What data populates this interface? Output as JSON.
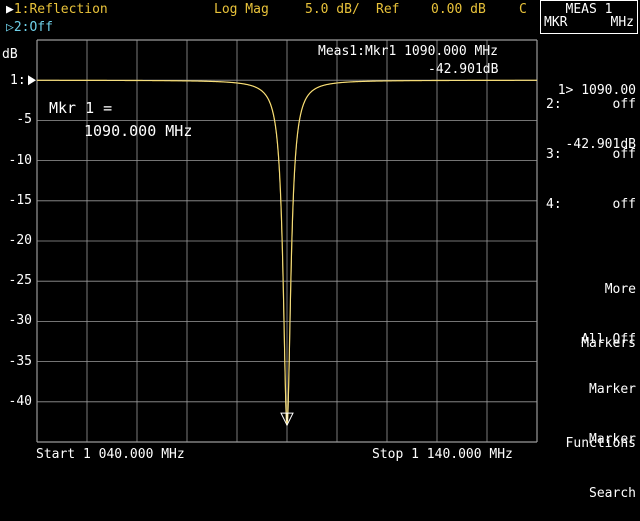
{
  "header": {
    "trace1": "1:Reflection",
    "trace2": "2:Off",
    "format": "Log Mag",
    "scale": "5.0 dB/",
    "ref_label": "Ref",
    "ref_value": "0.00 dB",
    "channel": "C"
  },
  "meas_box": {
    "line1": "MEAS 1",
    "line2_left": "MKR",
    "line2_right": "MHz"
  },
  "plot": {
    "y_unit": "dB",
    "ref_tick": "1:",
    "y_ticks": [
      "-5",
      "-10",
      "-15",
      "-20",
      "-25",
      "-30",
      "-35",
      "-40"
    ],
    "marker_readout_line1": "Meas1:Mkr1 1090.000 MHz",
    "marker_readout_line2": "-42.901dB",
    "mkr_label_line1": "Mkr 1 =",
    "mkr_label_line2": "1090.000 MHz",
    "start": "Start 1 040.000 MHz",
    "stop": "Stop 1 140.000 MHz"
  },
  "softkeys": {
    "mkr1_line1": "1> 1090.00",
    "mkr1_line2": "-42.901dB",
    "mkr2_label": "2:",
    "mkr2_value": "off",
    "mkr3_label": "3:",
    "mkr3_value": "off",
    "mkr4_label": "4:",
    "mkr4_value": "off",
    "more_markers_1": "More",
    "more_markers_2": "Markers",
    "all_off": "All Off",
    "marker_functions_1": "Marker",
    "marker_functions_2": "Functions",
    "marker_search_1": "Marker",
    "marker_search_2": "Search"
  },
  "colors": {
    "trace": "#e8c23a",
    "grid": "#9a9a9a",
    "inactive": "#6fd0e8"
  },
  "chart_data": {
    "type": "line",
    "x_unit": "MHz",
    "y_unit": "dB",
    "xlim": [
      1040,
      1140
    ],
    "ylim": [
      -45,
      5
    ],
    "resonance_mhz": 1090,
    "min_db": -42.901,
    "x": [
      1040,
      1050,
      1060,
      1070,
      1080,
      1085,
      1088,
      1089,
      1089.5,
      1090,
      1090.5,
      1091,
      1092,
      1095,
      1100,
      1110,
      1120,
      1130,
      1140
    ],
    "y": [
      0.0,
      -0.1,
      -0.3,
      -0.8,
      -2.8,
      -6.2,
      -13.0,
      -19.5,
      -27.0,
      -42.9,
      -27.0,
      -19.5,
      -13.0,
      -6.2,
      -2.8,
      -0.8,
      -0.3,
      -0.1,
      0.0
    ]
  }
}
